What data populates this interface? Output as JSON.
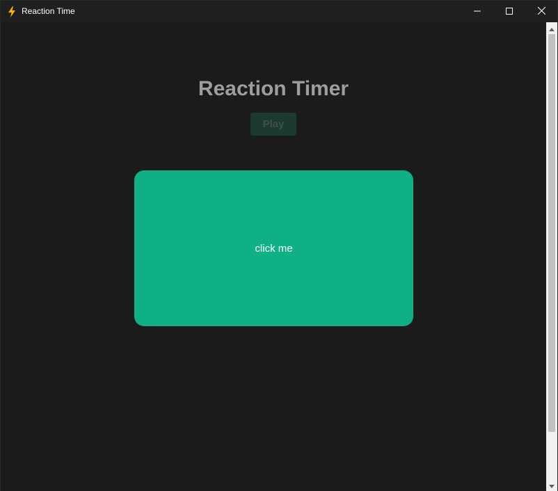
{
  "window": {
    "title": "Reaction Time",
    "icon": "lightning-icon",
    "controls": [
      "minimize-icon",
      "maximize-icon",
      "close-icon"
    ]
  },
  "page": {
    "title": "Reaction Timer",
    "play_label": "Play",
    "target_label": "click me"
  },
  "colors": {
    "target_bg": "#10b087",
    "play_bg": "#1d3a30",
    "background": "#1b1b1b",
    "title_text": "#9e9e9e",
    "icon_accent": "#f5b400"
  }
}
